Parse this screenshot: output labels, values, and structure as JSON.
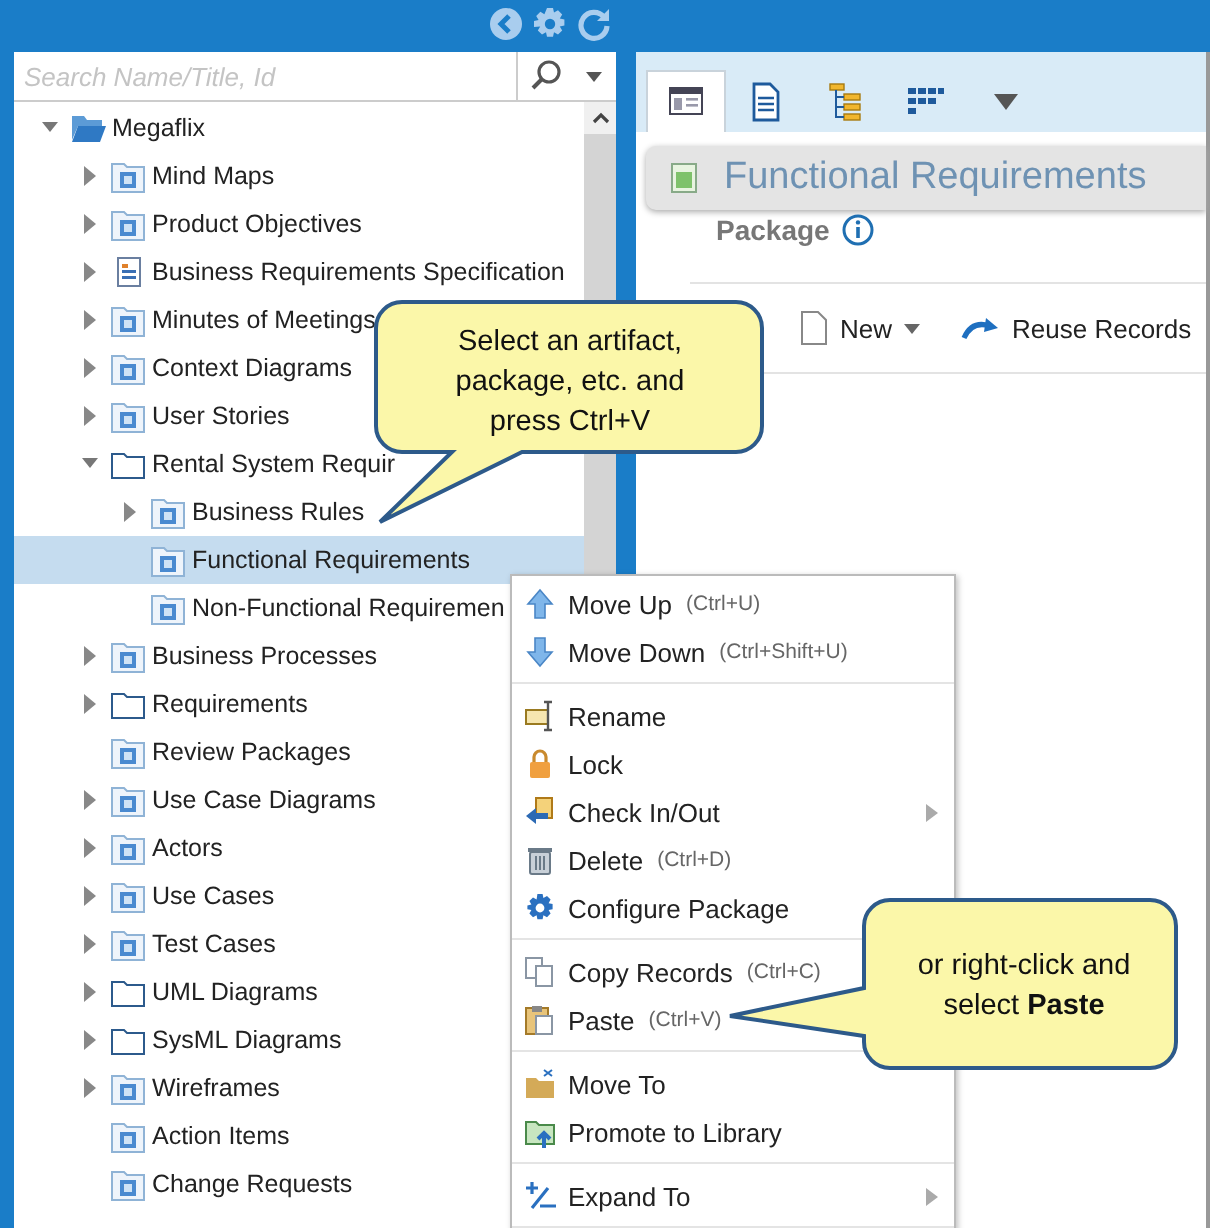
{
  "search": {
    "placeholder": "Search Name/Title, Id"
  },
  "tree": [
    {
      "label": "Megaflix",
      "kind": "open-folder",
      "expanded": true,
      "selected": false,
      "children": [
        {
          "label": "Mind Maps",
          "kind": "package",
          "expanded": false,
          "selected": false
        },
        {
          "label": "Product Objectives",
          "kind": "package",
          "expanded": false,
          "selected": false
        },
        {
          "label": "Business Requirements Specification",
          "kind": "document",
          "expanded": false,
          "selected": false
        },
        {
          "label": "Minutes of Meetings",
          "kind": "package",
          "expanded": false,
          "selected": false
        },
        {
          "label": "Context Diagrams",
          "kind": "package",
          "expanded": false,
          "selected": false
        },
        {
          "label": "User Stories",
          "kind": "package",
          "expanded": false,
          "selected": false
        },
        {
          "label": "Rental System Requir",
          "kind": "folder",
          "expanded": true,
          "selected": false,
          "children": [
            {
              "label": "Business Rules",
              "kind": "package",
              "expanded": false,
              "selected": false
            },
            {
              "label": "Functional Requirements",
              "kind": "package",
              "selected": true
            },
            {
              "label": "Non-Functional Requiremen",
              "kind": "package",
              "selected": false
            }
          ]
        },
        {
          "label": "Business Processes",
          "kind": "package",
          "expanded": false,
          "selected": false
        },
        {
          "label": "Requirements",
          "kind": "folder",
          "expanded": false,
          "selected": false
        },
        {
          "label": "Review Packages",
          "kind": "package",
          "selected": false
        },
        {
          "label": "Use Case Diagrams",
          "kind": "package",
          "expanded": false,
          "selected": false
        },
        {
          "label": "Actors",
          "kind": "package",
          "expanded": false,
          "selected": false
        },
        {
          "label": "Use Cases",
          "kind": "package",
          "expanded": false,
          "selected": false
        },
        {
          "label": "Test Cases",
          "kind": "package",
          "expanded": false,
          "selected": false
        },
        {
          "label": "UML Diagrams",
          "kind": "folder",
          "expanded": false,
          "selected": false
        },
        {
          "label": "SysML Diagrams",
          "kind": "folder",
          "expanded": false,
          "selected": false
        },
        {
          "label": "Wireframes",
          "kind": "package",
          "expanded": false,
          "selected": false
        },
        {
          "label": "Action Items",
          "kind": "package",
          "selected": false
        },
        {
          "label": "Change Requests",
          "kind": "package",
          "selected": false
        }
      ]
    }
  ],
  "tabs": [
    {
      "selected": true
    },
    {
      "selected": false
    },
    {
      "selected": false
    },
    {
      "selected": false
    }
  ],
  "header": {
    "title": "Functional Requirements",
    "subtitle": "Package"
  },
  "toolbar": [
    {
      "label": "New",
      "kind": "new"
    },
    {
      "label": "Reuse Records",
      "kind": "reuse"
    }
  ],
  "context_menu": [
    [
      {
        "label": "Move Up",
        "shortcut": "(Ctrl+U)",
        "kind": "up",
        "submenu": false
      },
      {
        "label": "Move Down",
        "shortcut": "(Ctrl+Shift+U)",
        "kind": "down",
        "submenu": false
      }
    ],
    [
      {
        "label": "Rename",
        "kind": "rename",
        "submenu": false
      },
      {
        "label": "Lock",
        "kind": "lock",
        "submenu": false
      },
      {
        "label": "Check In/Out",
        "kind": "checkin",
        "submenu": true
      },
      {
        "label": "Delete",
        "shortcut": "(Ctrl+D)",
        "kind": "delete",
        "submenu": false
      },
      {
        "label": "Configure Package",
        "kind": "gear",
        "submenu": false
      }
    ],
    [
      {
        "label": "Copy Records",
        "shortcut": "(Ctrl+C)",
        "kind": "copy",
        "submenu": false
      },
      {
        "label": "Paste",
        "shortcut": "(Ctrl+V)",
        "kind": "paste",
        "submenu": false
      }
    ],
    [
      {
        "label": "Move To",
        "kind": "moveto",
        "submenu": false
      },
      {
        "label": "Promote to Library",
        "kind": "promote",
        "submenu": false
      }
    ],
    [
      {
        "label": "Expand To",
        "kind": "expand",
        "submenu": true
      }
    ]
  ],
  "callouts": [
    {
      "text": "Select an artifact, package, etc. and press Ctrl+V",
      "kind": "down-left"
    },
    {
      "text": "or right-click and select **Paste**",
      "kind": "left"
    }
  ]
}
